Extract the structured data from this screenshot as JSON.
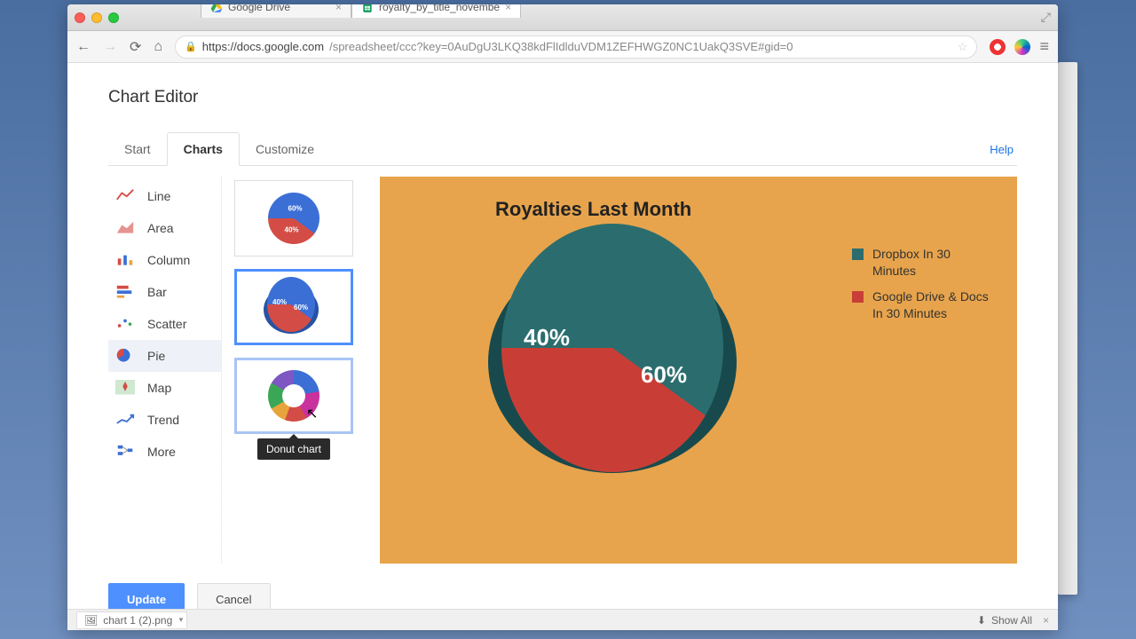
{
  "browser": {
    "tab1": "Google Drive",
    "tab2": "royalty_by_title_novembe",
    "url_host": "https://docs.google.com",
    "url_path": "/spreadsheet/ccc?key=0AuDgU3LKQ38kdFlIdlduVDM1ZEFHWGZ0NC1UakQ3SVE#gid=0"
  },
  "page": {
    "title": "Chart Editor",
    "tabs": {
      "start": "Start",
      "charts": "Charts",
      "customize": "Customize"
    },
    "help": "Help"
  },
  "chart_types": {
    "line": "Line",
    "area": "Area",
    "column": "Column",
    "bar": "Bar",
    "scatter": "Scatter",
    "pie": "Pie",
    "map": "Map",
    "trend": "Trend",
    "more": "More"
  },
  "tooltip": {
    "donut": "Donut chart"
  },
  "thumb_labels": {
    "a": "40%",
    "b": "60%"
  },
  "preview": {
    "title": "Royalties Last Month",
    "label40": "40%",
    "label60": "60%",
    "legend1": "Dropbox In 30 Minutes",
    "legend2": "Google Drive & Docs In 30 Minutes"
  },
  "buttons": {
    "update": "Update",
    "cancel": "Cancel"
  },
  "downloads": {
    "file": "chart 1 (2).png",
    "show_all": "Show All"
  },
  "chart_data": {
    "type": "pie",
    "title": "Royalties Last Month",
    "series": [
      {
        "name": "Dropbox In 30 Minutes",
        "value": 60,
        "color": "#2b6d6e"
      },
      {
        "name": "Google Drive & Docs In 30 Minutes",
        "value": 40,
        "color": "#c83e36"
      }
    ]
  }
}
